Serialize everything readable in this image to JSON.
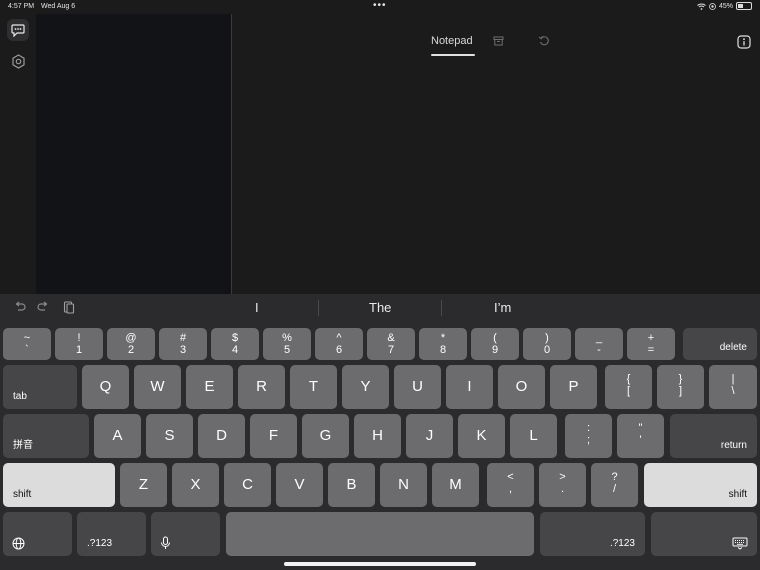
{
  "status": {
    "time": "4:57 PM",
    "date": "Wed Aug 6",
    "battery": "45%",
    "battery_level": 0.45
  },
  "main": {
    "tab_label": "Notepad"
  },
  "suggestions": [
    "I",
    "The",
    "I’m"
  ],
  "keyboard": {
    "row1": [
      {
        "top": "~",
        "bot": "`"
      },
      {
        "top": "!",
        "bot": "1"
      },
      {
        "top": "@",
        "bot": "2"
      },
      {
        "top": "#",
        "bot": "3"
      },
      {
        "top": "$",
        "bot": "4"
      },
      {
        "top": "%",
        "bot": "5"
      },
      {
        "top": "^",
        "bot": "6"
      },
      {
        "top": "&",
        "bot": "7"
      },
      {
        "top": "*",
        "bot": "8"
      },
      {
        "top": "(",
        "bot": "9"
      },
      {
        "top": ")",
        "bot": "0"
      },
      {
        "top": "_",
        "bot": "-"
      },
      {
        "top": "+",
        "bot": "="
      }
    ],
    "delete": "delete",
    "tab": "tab",
    "row2": [
      "Q",
      "W",
      "E",
      "R",
      "T",
      "Y",
      "U",
      "I",
      "O",
      "P"
    ],
    "row2_sym": [
      {
        "top": "{",
        "bot": "["
      },
      {
        "top": "}",
        "bot": "]"
      },
      {
        "top": "|",
        "bot": "\\"
      }
    ],
    "pinyin": "拼音",
    "row3": [
      "A",
      "S",
      "D",
      "F",
      "G",
      "H",
      "J",
      "K",
      "L"
    ],
    "row3_sym": [
      {
        "top": ":",
        "bot": ";"
      },
      {
        "top": "\"",
        "bot": "'"
      }
    ],
    "return": "return",
    "shift": "shift",
    "row4": [
      "Z",
      "X",
      "C",
      "V",
      "B",
      "N",
      "M"
    ],
    "row4_sym": [
      {
        "top": "<",
        "bot": ","
      },
      {
        "top": ">",
        "bot": "."
      },
      {
        "top": "?",
        "bot": "/"
      }
    ],
    "num_label": ".?123"
  }
}
